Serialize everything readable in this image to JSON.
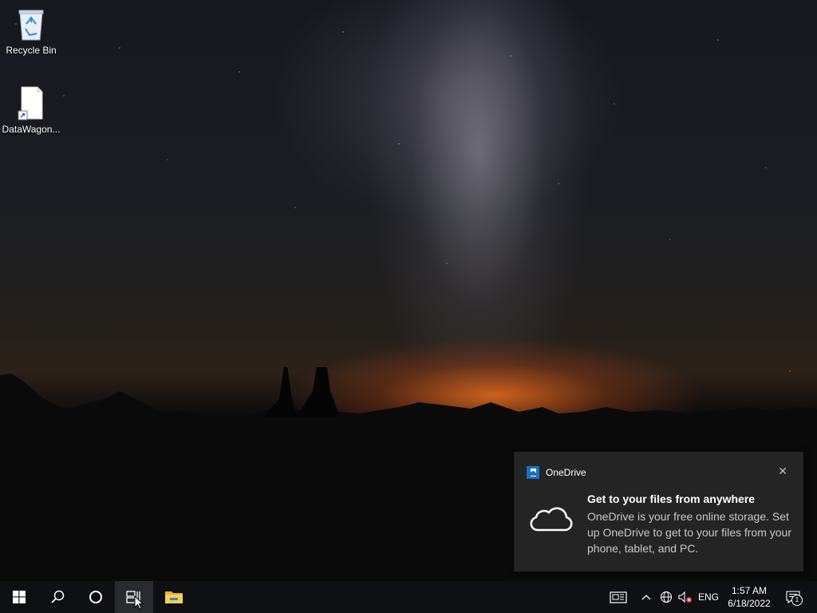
{
  "desktop": {
    "icons": [
      {
        "label": "Recycle Bin",
        "icon": "recycle-bin-icon"
      },
      {
        "label": "DataWagon...",
        "icon": "shortcut-file-icon"
      }
    ]
  },
  "toast": {
    "app_name": "OneDrive",
    "title": "Get to your files from anywhere",
    "body": "OneDrive is your free online storage. Set up OneDrive to get to your files from your phone, tablet, and PC.",
    "close_glyph": "✕",
    "app_icon": "onedrive-app-icon",
    "hero_icon": "cloud-icon"
  },
  "taskbar": {
    "buttons": [
      {
        "name": "start",
        "icon": "windows-logo-icon"
      },
      {
        "name": "search",
        "icon": "search-icon"
      },
      {
        "name": "cortana",
        "icon": "cortana-circle-icon"
      },
      {
        "name": "task-view",
        "icon": "task-view-icon"
      },
      {
        "name": "file-explorer",
        "icon": "folder-icon"
      }
    ],
    "tray": {
      "language": "ENG",
      "time": "1:57 AM",
      "date": "6/18/2022",
      "notification_count": "1"
    }
  },
  "colors": {
    "taskbar": "#0f1013",
    "toast_bg": "#242424",
    "onedrive_blue": "#1a6fc0",
    "muted_red": "#d13438"
  }
}
